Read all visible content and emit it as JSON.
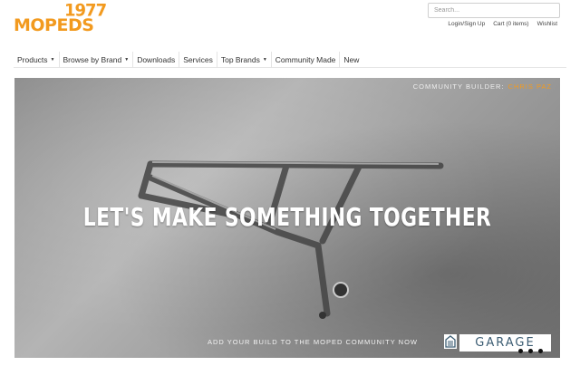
{
  "brand": {
    "year": "1977",
    "name": "MOPEDS",
    "color": "#f29a1f"
  },
  "search": {
    "placeholder": "Search..."
  },
  "toplinks": [
    "Login/Sign Up",
    "Cart (0 items)",
    "Wishlist"
  ],
  "nav": [
    {
      "label": "Products",
      "dropdown": true
    },
    {
      "label": "Browse by Brand",
      "dropdown": true
    },
    {
      "label": "Downloads",
      "dropdown": false
    },
    {
      "label": "Services",
      "dropdown": false
    },
    {
      "label": "Top Brands",
      "dropdown": true
    },
    {
      "label": "Community Made",
      "dropdown": false
    },
    {
      "label": "New",
      "dropdown": false
    }
  ],
  "hero": {
    "builder_label": "COMMUNITY BUILDER:",
    "builder_name": "CHRIS PAZ",
    "headline": "LET'S MAKE SOMETHING TOGETHER",
    "cta": "ADD YOUR BUILD TO THE MOPED COMMUNITY NOW",
    "garage_label": "GARAGE",
    "slides": 3,
    "icon": "garage-icon"
  }
}
